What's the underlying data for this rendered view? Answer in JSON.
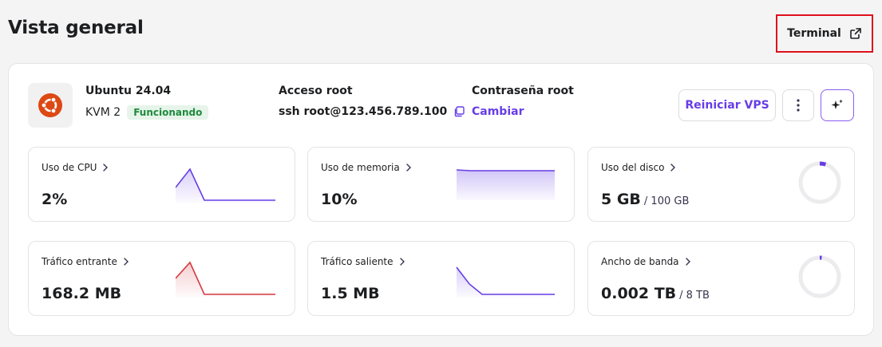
{
  "header": {
    "title": "Vista general",
    "terminal_label": "Terminal"
  },
  "server": {
    "os_name": "Ubuntu 24.04",
    "plan": "KVM 2",
    "status": "Funcionando",
    "root_access_label": "Acceso root",
    "root_access_value": "ssh root@123.456.789.100",
    "root_password_label": "Contraseña root",
    "root_password_action": "Cambiar"
  },
  "actions": {
    "restart_label": "Reiniciar VPS"
  },
  "colors": {
    "accent": "#673de6",
    "inbound": "#d63940",
    "status_green": "#1e8a3c",
    "terminal_highlight": "#e0101c",
    "ubuntu_orange": "#dd4814"
  },
  "metrics": {
    "cpu": {
      "title": "Uso de CPU",
      "value": "2%"
    },
    "memory": {
      "title": "Uso de memoria",
      "value": "10%"
    },
    "disk": {
      "title": "Uso del disco",
      "value": "5 GB",
      "total": "/ 100 GB",
      "fraction": 0.05
    },
    "traffic_in": {
      "title": "Tráfico entrante",
      "value": "168.2 MB"
    },
    "traffic_out": {
      "title": "Tráfico saliente",
      "value": "1.5 MB"
    },
    "bandwidth": {
      "title": "Ancho de banda",
      "value": "0.002 TB",
      "total": "/ 8 TB",
      "fraction": 0.0003
    }
  }
}
